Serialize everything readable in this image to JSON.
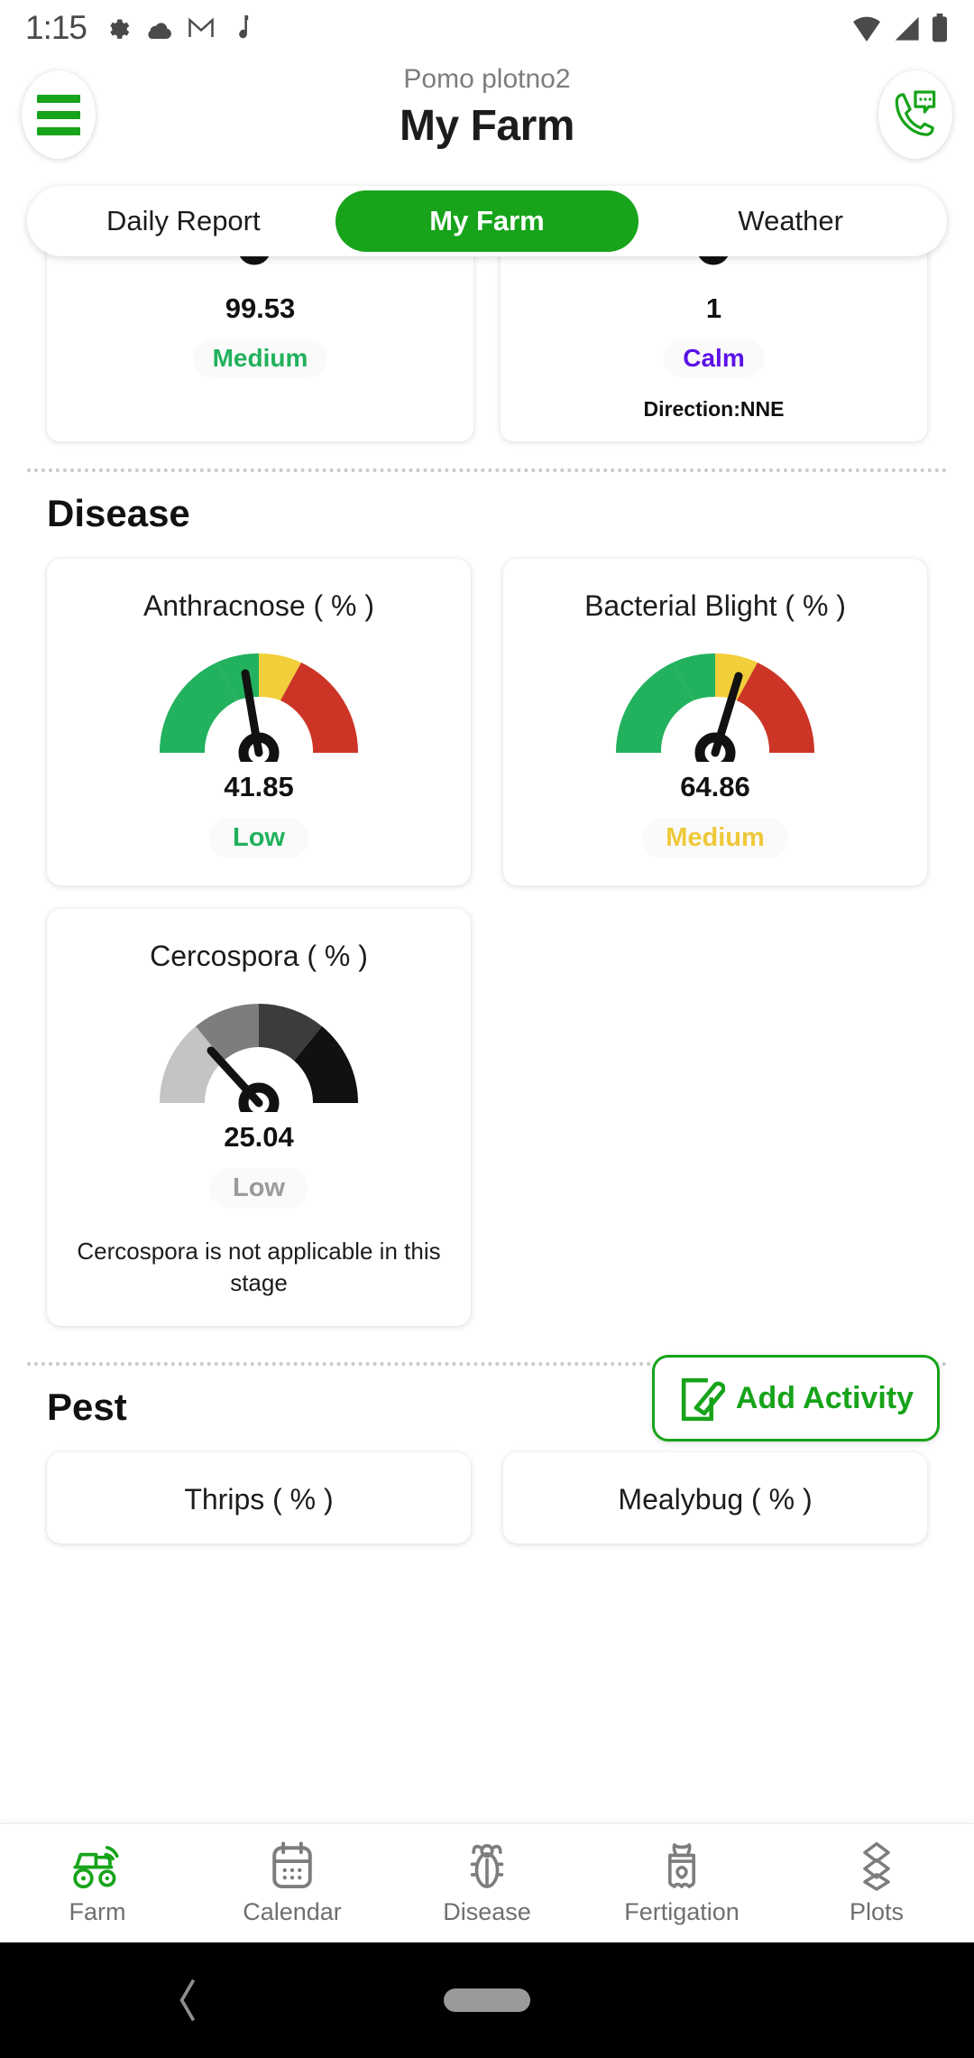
{
  "status_bar": {
    "time": "1:15",
    "left_icons": [
      "gear-icon",
      "cloud-icon",
      "gmail-icon",
      "music-note-icon"
    ],
    "right_icons": [
      "wifi-icon",
      "signal-icon",
      "battery-icon"
    ]
  },
  "app_bar": {
    "menu_icon": "hamburger-menu-icon",
    "subtitle": "Pomo plotno2",
    "title": "My Farm",
    "call_icon": "phone-chat-icon"
  },
  "tabs": [
    {
      "label": "Daily Report",
      "active": false
    },
    {
      "label": "My Farm",
      "active": true
    },
    {
      "label": "Weather",
      "active": false
    }
  ],
  "top_cards": [
    {
      "value": "99.53",
      "status": "Medium",
      "status_color": "#21b15c",
      "extra": ""
    },
    {
      "value": "1",
      "status": "Calm",
      "status_color": "#5b11e8",
      "extra": "Direction:NNE"
    }
  ],
  "disease": {
    "heading": "Disease",
    "cards": [
      {
        "title": "Anthracnose ( % )",
        "value": "41.85",
        "status": "Low",
        "status_color": "#21b15c",
        "needle_percent": 41.85,
        "palette": [
          "#22b15d",
          "#f2ce3a",
          "#cc3526"
        ],
        "note": ""
      },
      {
        "title": "Bacterial Blight ( % )",
        "value": "64.86",
        "status": "Medium",
        "status_color": "#efc83a",
        "needle_percent": 64.86,
        "palette": [
          "#22b15d",
          "#f2ce3a",
          "#cc3526"
        ],
        "note": ""
      },
      {
        "title": "Cercospora ( % )",
        "value": "25.04",
        "status": "Low",
        "status_color": "#9a9a9a",
        "needle_percent": 25.04,
        "palette": [
          "#c4c4c4",
          "#7d7d7d",
          "#262626"
        ],
        "note": "Cercospora is not applicable in this stage"
      }
    ]
  },
  "pest": {
    "heading": "Pest",
    "add_activity": {
      "label": "Add Activity",
      "icon": "edit-note-icon"
    },
    "cards": [
      {
        "title": "Thrips ( % )"
      },
      {
        "title": "Mealybug ( % )"
      }
    ]
  },
  "bottom_nav": [
    {
      "label": "Farm",
      "icon": "tractor-icon",
      "active": true
    },
    {
      "label": "Calendar",
      "icon": "calendar-icon",
      "active": false
    },
    {
      "label": "Disease",
      "icon": "bug-icon",
      "active": false
    },
    {
      "label": "Fertigation",
      "icon": "fertilizer-bag-icon",
      "active": false
    },
    {
      "label": "Plots",
      "icon": "layers-icon",
      "active": false
    }
  ],
  "system_nav": {
    "back_icon": "back-chevron-icon",
    "home_pill": "home-pill"
  },
  "theme": {
    "accent": "#17a31a",
    "text": "#1c1c1c",
    "muted": "#7d7d7d"
  }
}
